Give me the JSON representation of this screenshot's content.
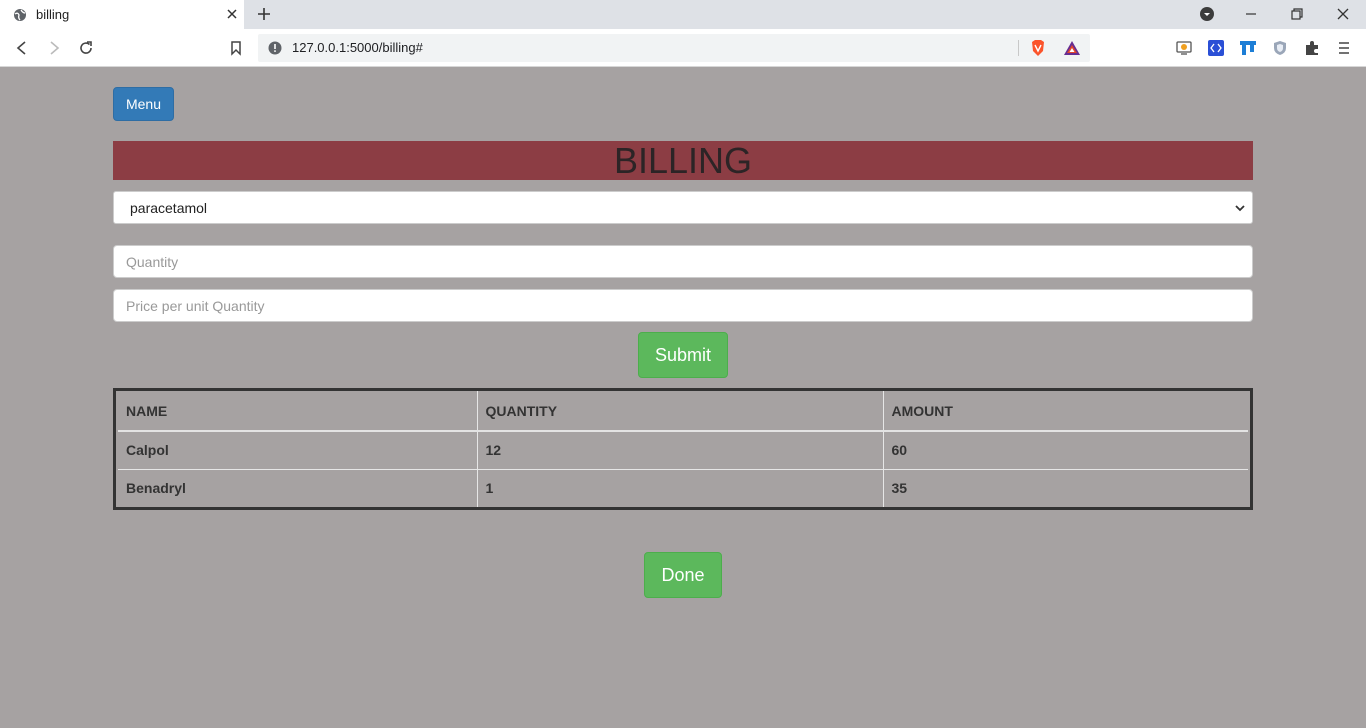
{
  "browser": {
    "tab_title": "billing",
    "url": "127.0.0.1:5000/billing#"
  },
  "page": {
    "menu_label": "Menu",
    "banner_title": "BILLING",
    "select_value": "paracetamol",
    "quantity_placeholder": "Quantity",
    "price_placeholder": "Price per unit Quantity",
    "submit_label": "Submit",
    "done_label": "Done"
  },
  "table": {
    "headers": [
      "NAME",
      "QUANTITY",
      "AMOUNT"
    ],
    "rows": [
      [
        "Calpol",
        "12",
        "60"
      ],
      [
        "Benadryl",
        "1",
        "35"
      ]
    ]
  },
  "colors": {
    "page_bg": "#a6a2a2",
    "banner_bg": "#8c3d44",
    "primary_button": "#337ab7",
    "success_button": "#5cb85c"
  }
}
